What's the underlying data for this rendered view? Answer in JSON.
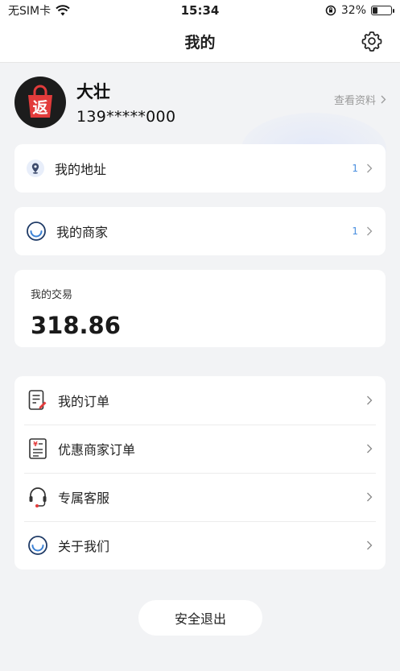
{
  "status_bar": {
    "carrier": "无SIM卡",
    "time": "15:34",
    "battery_percent": "32%",
    "battery_level": 0.32
  },
  "nav": {
    "title": "我的"
  },
  "profile": {
    "avatar_text": "返",
    "name": "大壮",
    "phone": "139*****000",
    "view_profile": "查看资料"
  },
  "address": {
    "label": "我的地址",
    "count": "1"
  },
  "merchant": {
    "label": "我的商家",
    "count": "1"
  },
  "trade": {
    "label": "我的交易",
    "value": "318.86"
  },
  "menu": {
    "items": [
      {
        "label": "我的订单",
        "icon": "order-icon"
      },
      {
        "label": "优惠商家订单",
        "icon": "receipt-icon"
      },
      {
        "label": "专属客服",
        "icon": "headset-icon"
      },
      {
        "label": "关于我们",
        "icon": "smile-circle-icon"
      }
    ]
  },
  "logout": {
    "label": "安全退出"
  },
  "colors": {
    "accent_blue": "#4a8fe0",
    "avatar_red": "#e23b3b",
    "background": "#f2f3f5"
  }
}
